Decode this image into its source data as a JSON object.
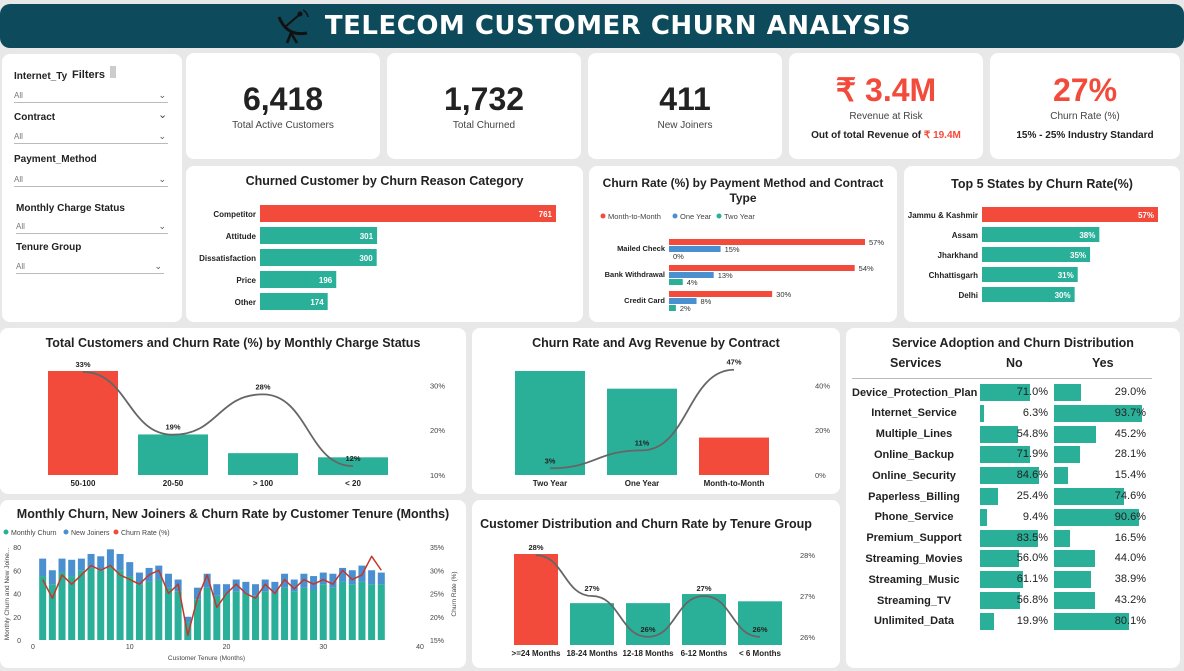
{
  "header": {
    "title": "TELECOM CUSTOMER CHURN ANALYSIS"
  },
  "filters": {
    "title": "Filters",
    "items": [
      {
        "label": "Internet_Ty",
        "value": "All"
      },
      {
        "label": "Contract",
        "value": "All"
      },
      {
        "label": "Payment_Method",
        "value": "All"
      },
      {
        "label": "Monthly Charge Status",
        "value": "All"
      },
      {
        "label": "Tenure Group",
        "value": "All"
      }
    ]
  },
  "kpis": [
    {
      "value": "6,418",
      "label": "Total Active Customers"
    },
    {
      "value": "1,732",
      "label": "Total Churned"
    },
    {
      "value": "411",
      "label": "New Joiners"
    },
    {
      "value": "₹ 3.4M",
      "label": "Revenue at Risk",
      "note_prefix": "Out of total Revenue of ",
      "note_value": "₹ 19.4M"
    },
    {
      "value": "27%",
      "label": "Churn Rate (%)",
      "note": "15% - 25% Industry Standard"
    }
  ],
  "colors": {
    "teal": "#2aaf98",
    "red": "#f24b3b",
    "blue": "#4a8fd0",
    "line": "#666666",
    "header": "#0d4a5b"
  },
  "chart_data": [
    {
      "id": "reason",
      "type": "bar",
      "orientation": "horizontal",
      "title": "Churned Customer by Churn Reason Category",
      "categories": [
        "Competitor",
        "Attitude",
        "Dissatisfaction",
        "Price",
        "Other"
      ],
      "values": [
        761,
        301,
        300,
        196,
        174
      ],
      "labels": [
        "761",
        "301",
        "300",
        "196",
        "174"
      ]
    },
    {
      "id": "payment",
      "type": "bar",
      "orientation": "horizontal",
      "title_line1": "Churn Rate (%) by Payment Method and Contract",
      "title_line2": "Type",
      "categories": [
        "Mailed Check",
        "Bank Withdrawal",
        "Credit Card"
      ],
      "series": [
        {
          "name": "Month-to-Month",
          "values": [
            57,
            54,
            30
          ],
          "labels": [
            "57%",
            "54%",
            "30%"
          ]
        },
        {
          "name": "One Year",
          "values": [
            15,
            13,
            8
          ],
          "labels": [
            "15%",
            "13%",
            "8%"
          ]
        },
        {
          "name": "Two Year",
          "values": [
            0,
            4,
            2
          ],
          "labels": [
            "0%",
            "4%",
            "2%"
          ]
        }
      ]
    },
    {
      "id": "states",
      "type": "bar",
      "orientation": "horizontal",
      "title": "Top 5 States by Churn Rate(%)",
      "categories": [
        "Jammu & Kashmir",
        "Assam",
        "Jharkhand",
        "Chhattisgarh",
        "Delhi"
      ],
      "values": [
        57,
        38,
        35,
        31,
        30
      ],
      "labels": [
        "57%",
        "38%",
        "35%",
        "31%",
        "30%"
      ]
    },
    {
      "id": "charge",
      "type": "bar",
      "title": "Total Customers and Churn Rate (%) by Monthly Charge Status",
      "categories": [
        "50-100",
        "20-50",
        "> 100",
        "< 20"
      ],
      "bar_values": [
        100,
        39,
        21,
        17
      ],
      "line_values": [
        33,
        19,
        28,
        12
      ],
      "line_labels": [
        "33%",
        "19%",
        "28%",
        "12%"
      ],
      "y2_ticks": [
        "10%",
        "20%",
        "30%"
      ],
      "y2_range": [
        10,
        35
      ]
    },
    {
      "id": "contract",
      "type": "bar",
      "title": "Churn Rate and Avg Revenue by Contract",
      "categories": [
        "Two Year",
        "One Year",
        "Month-to-Month"
      ],
      "bar_values": [
        100,
        83,
        36
      ],
      "line_values": [
        3,
        11,
        47
      ],
      "line_labels": [
        "3%",
        "11%",
        "47%"
      ],
      "y2_ticks": [
        "0%",
        "20%",
        "40%"
      ],
      "y2_range": [
        0,
        50
      ]
    },
    {
      "id": "tenure_months",
      "type": "bar",
      "title": "Monthly Churn, New Joiners & Churn Rate by Customer Tenure (Months)",
      "legend": [
        "Monthly Churn",
        "New Joiners",
        "Churn Rate (%)"
      ],
      "xlabel": "Customer Tenure (Months)",
      "ylabel": "Monthly Churn and New Joine...",
      "y2label": "Churn Rate (%)",
      "x_ticks": [
        "0",
        "10",
        "20",
        "30",
        "40"
      ],
      "y_ticks": [
        "0",
        "20",
        "40",
        "60",
        "80"
      ],
      "y2_ticks": [
        "15%",
        "20%",
        "25%",
        "30%",
        "35%"
      ],
      "x": [
        1,
        2,
        3,
        4,
        5,
        6,
        7,
        8,
        9,
        10,
        11,
        12,
        13,
        14,
        15,
        16,
        17,
        18,
        19,
        20,
        21,
        22,
        23,
        24,
        25,
        26,
        27,
        28,
        29,
        30,
        31,
        32,
        33,
        34,
        35,
        36
      ],
      "churn": [
        55,
        48,
        58,
        55,
        60,
        62,
        60,
        63,
        60,
        55,
        48,
        50,
        52,
        45,
        42,
        15,
        35,
        45,
        38,
        40,
        42,
        40,
        38,
        42,
        40,
        45,
        42,
        45,
        43,
        48,
        45,
        50,
        48,
        50,
        48,
        48
      ],
      "joiners": [
        15,
        12,
        12,
        14,
        10,
        12,
        12,
        15,
        14,
        12,
        10,
        12,
        12,
        12,
        10,
        5,
        10,
        12,
        10,
        8,
        10,
        10,
        10,
        10,
        10,
        12,
        10,
        12,
        12,
        10,
        12,
        12,
        12,
        14,
        12,
        10
      ],
      "churn_rate": [
        28,
        24,
        29,
        27,
        29,
        31,
        30,
        31,
        29,
        28,
        27,
        29,
        30,
        25,
        27,
        16,
        24,
        29,
        22,
        25,
        27,
        25,
        24,
        27,
        25,
        28,
        26,
        28,
        27,
        28,
        27,
        30,
        28,
        29,
        33,
        30
      ]
    },
    {
      "id": "tenure_group",
      "type": "bar",
      "title": "Customer Distribution and Churn Rate by Tenure Group",
      "categories": [
        ">=24 Months",
        "18-24 Months",
        "12-18 Months",
        "6-12 Months",
        "< 6 Months"
      ],
      "bar_values": [
        100,
        46,
        46,
        56,
        48
      ],
      "line_values": [
        28,
        27,
        26,
        27,
        26
      ],
      "line_labels": [
        "28%",
        "27%",
        "26%",
        "27%",
        "26%"
      ],
      "y2_ticks": [
        "26%",
        "27%",
        "28%"
      ],
      "y2_range": [
        25.8,
        28.2
      ]
    }
  ],
  "services": {
    "title": "Service Adoption and Churn Distribution",
    "headers": [
      "Services",
      "No",
      "Yes"
    ],
    "rows": [
      {
        "name": "Device_Protection_Plan",
        "no": 71.0,
        "yes": 29.0,
        "no_label": "71.0%",
        "yes_label": "29.0%"
      },
      {
        "name": "Internet_Service",
        "no": 6.3,
        "yes": 93.7,
        "no_label": "6.3%",
        "yes_label": "93.7%"
      },
      {
        "name": "Multiple_Lines",
        "no": 54.8,
        "yes": 45.2,
        "no_label": "54.8%",
        "yes_label": "45.2%"
      },
      {
        "name": "Online_Backup",
        "no": 71.9,
        "yes": 28.1,
        "no_label": "71.9%",
        "yes_label": "28.1%"
      },
      {
        "name": "Online_Security",
        "no": 84.6,
        "yes": 15.4,
        "no_label": "84.6%",
        "yes_label": "15.4%"
      },
      {
        "name": "Paperless_Billing",
        "no": 25.4,
        "yes": 74.6,
        "no_label": "25.4%",
        "yes_label": "74.6%"
      },
      {
        "name": "Phone_Service",
        "no": 9.4,
        "yes": 90.6,
        "no_label": "9.4%",
        "yes_label": "90.6%"
      },
      {
        "name": "Premium_Support",
        "no": 83.5,
        "yes": 16.5,
        "no_label": "83.5%",
        "yes_label": "16.5%"
      },
      {
        "name": "Streaming_Movies",
        "no": 56.0,
        "yes": 44.0,
        "no_label": "56.0%",
        "yes_label": "44.0%"
      },
      {
        "name": "Streaming_Music",
        "no": 61.1,
        "yes": 38.9,
        "no_label": "61.1%",
        "yes_label": "38.9%"
      },
      {
        "name": "Streaming_TV",
        "no": 56.8,
        "yes": 43.2,
        "no_label": "56.8%",
        "yes_label": "43.2%"
      },
      {
        "name": "Unlimited_Data",
        "no": 19.9,
        "yes": 80.1,
        "no_label": "19.9%",
        "yes_label": "80.1%"
      }
    ]
  }
}
